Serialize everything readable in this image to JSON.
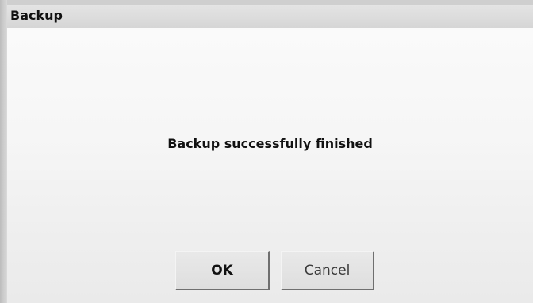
{
  "window": {
    "title": "Backup"
  },
  "dialog": {
    "message": "Backup successfully finished"
  },
  "buttons": {
    "ok_label": "OK",
    "cancel_label": "Cancel"
  }
}
